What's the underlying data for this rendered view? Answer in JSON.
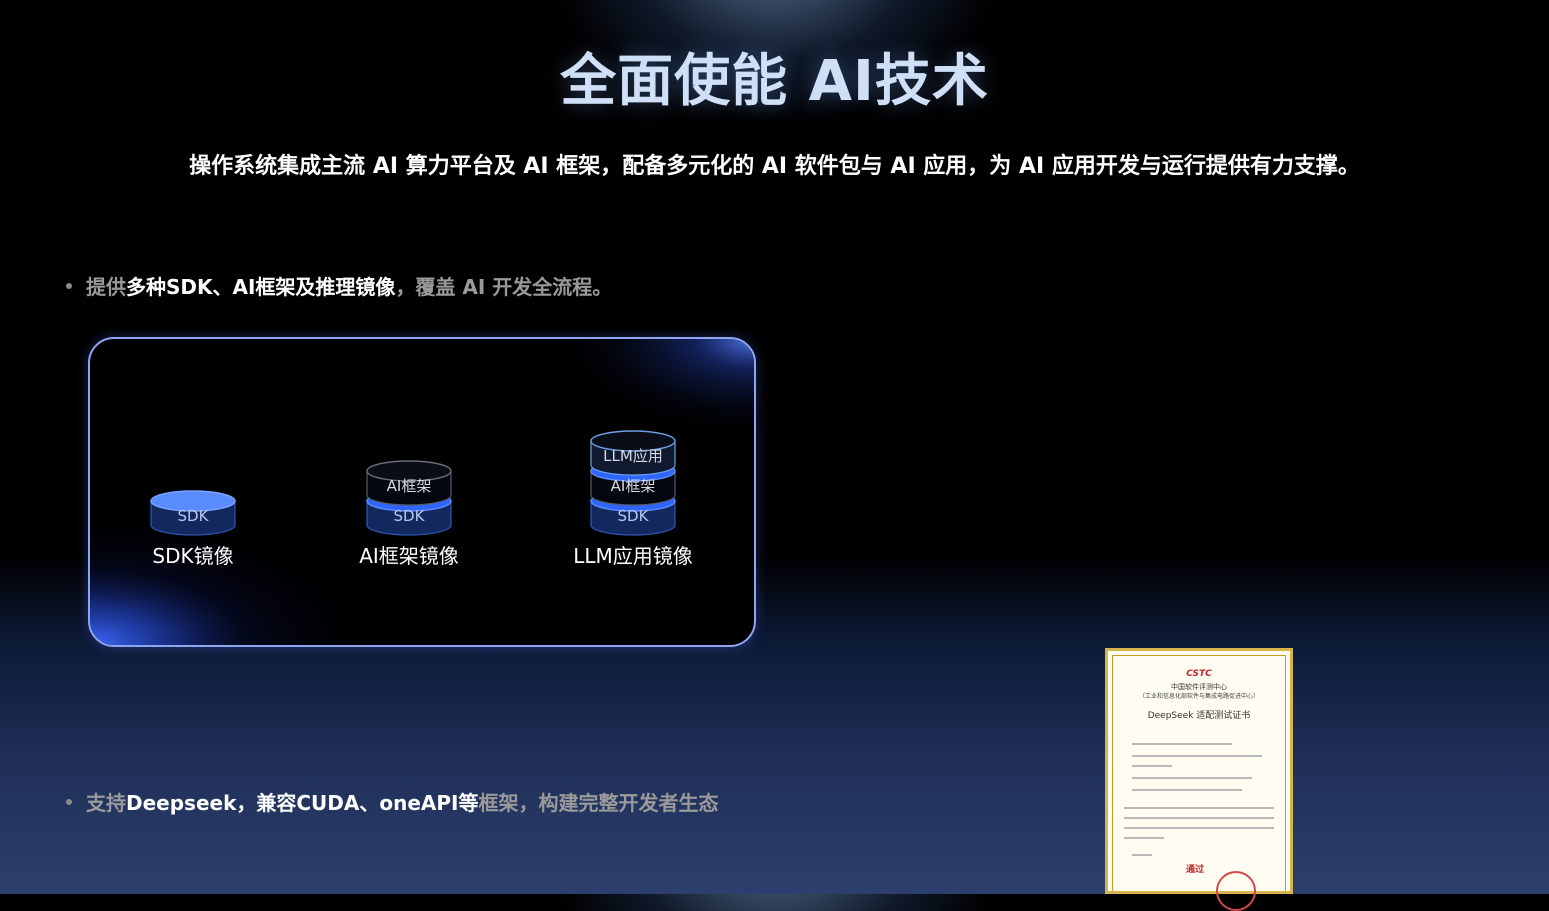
{
  "header": {
    "title": "全面使能 AI技术",
    "subtitle": "操作系统集成主流 AI 算力平台及 AI 框架，配备多元化的 AI 软件包与 AI 应用，为 AI 应用开发与运行提供有力支撑。"
  },
  "bullets": [
    {
      "pre": "提供",
      "highlight": "多种SDK、AI框架及推理镜像",
      "post": "，覆盖 AI 开发全流程。"
    },
    {
      "pre": "支持",
      "highlight": "Deepseek，兼容CUDA、oneAPI等",
      "post": "框架，构建完整开发者生态"
    }
  ],
  "stacks": [
    {
      "label": "SDK镜像",
      "layers": [
        "SDK"
      ]
    },
    {
      "label": "AI框架镜像",
      "layers": [
        "SDK",
        "AI框架"
      ]
    },
    {
      "label": "LLM应用镜像",
      "layers": [
        "SDK",
        "AI框架",
        "LLM应用"
      ]
    }
  ],
  "certificate": {
    "logo": "CSTC",
    "org": "中国软件评测中心",
    "org_sub": "（工业和信息化部软件与集成电路促进中心）",
    "title": "DeepSeek 适配测试证书",
    "result": "通过"
  },
  "colors": {
    "accent": "#4a7dff",
    "card_border": "#8ea6ee",
    "bullet_muted": "#9a9a9a"
  }
}
